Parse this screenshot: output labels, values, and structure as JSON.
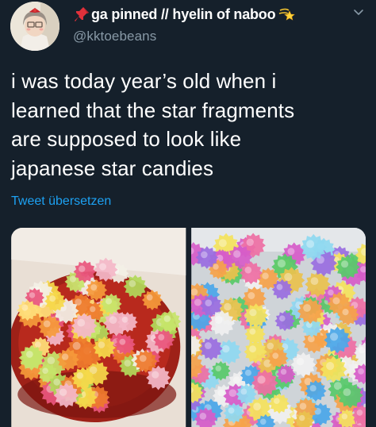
{
  "tweet": {
    "display_name": "ga pinned // hyelin of naboo",
    "handle": "@kktoebeans",
    "text": "i was today year’s old when i\nlearned that the star fragments\nare supposed to look like\njapanese star candies",
    "translate_label": "Tweet übersetzen"
  },
  "icons": {
    "pin": "pushpin-icon",
    "star": "shooting-star-icon",
    "caret": "chevron-down-icon"
  },
  "colors": {
    "background": "#15202b",
    "text": "#ffffff",
    "secondary": "#8899a6",
    "link": "#1da1f2"
  }
}
